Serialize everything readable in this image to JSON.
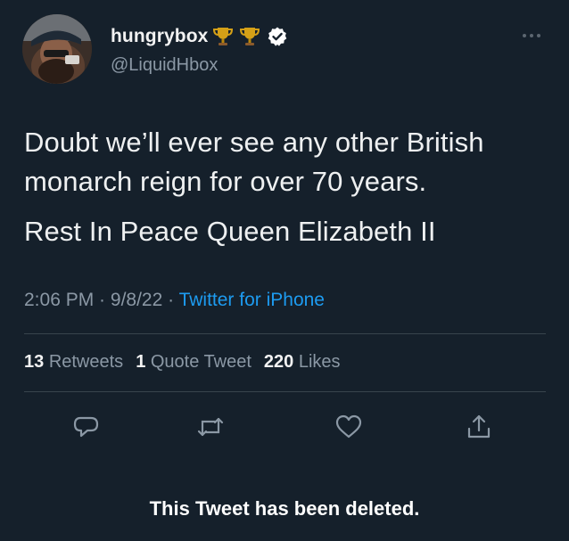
{
  "user": {
    "display_name": "hungrybox",
    "handle": "@LiquidHbox",
    "badges": [
      "trophy-icon",
      "trophy-icon",
      "verified-icon"
    ]
  },
  "tweet": {
    "lines": [
      "Doubt we’ll ever see any other British monarch reign for over 70 years.",
      "Rest In Peace Queen Elizabeth II"
    ],
    "time": "2:06 PM",
    "date": "9/8/22",
    "separator": " · ",
    "source": "Twitter for iPhone"
  },
  "stats": {
    "retweets_count": "13",
    "retweets_label": "Retweets",
    "quotes_count": "1",
    "quotes_label": "Quote Tweet",
    "likes_count": "220",
    "likes_label": "Likes"
  },
  "actions": [
    "reply-icon",
    "retweet-icon",
    "like-icon",
    "share-icon"
  ],
  "footer": {
    "deleted_notice": "This Tweet has been deleted."
  },
  "colors": {
    "background": "#15202b",
    "text": "#e7e9ea",
    "secondary": "#8b98a5",
    "link": "#1d9bf0",
    "divider": "#38444d",
    "verified": "#ffffff",
    "trophy": "#d4a017"
  }
}
